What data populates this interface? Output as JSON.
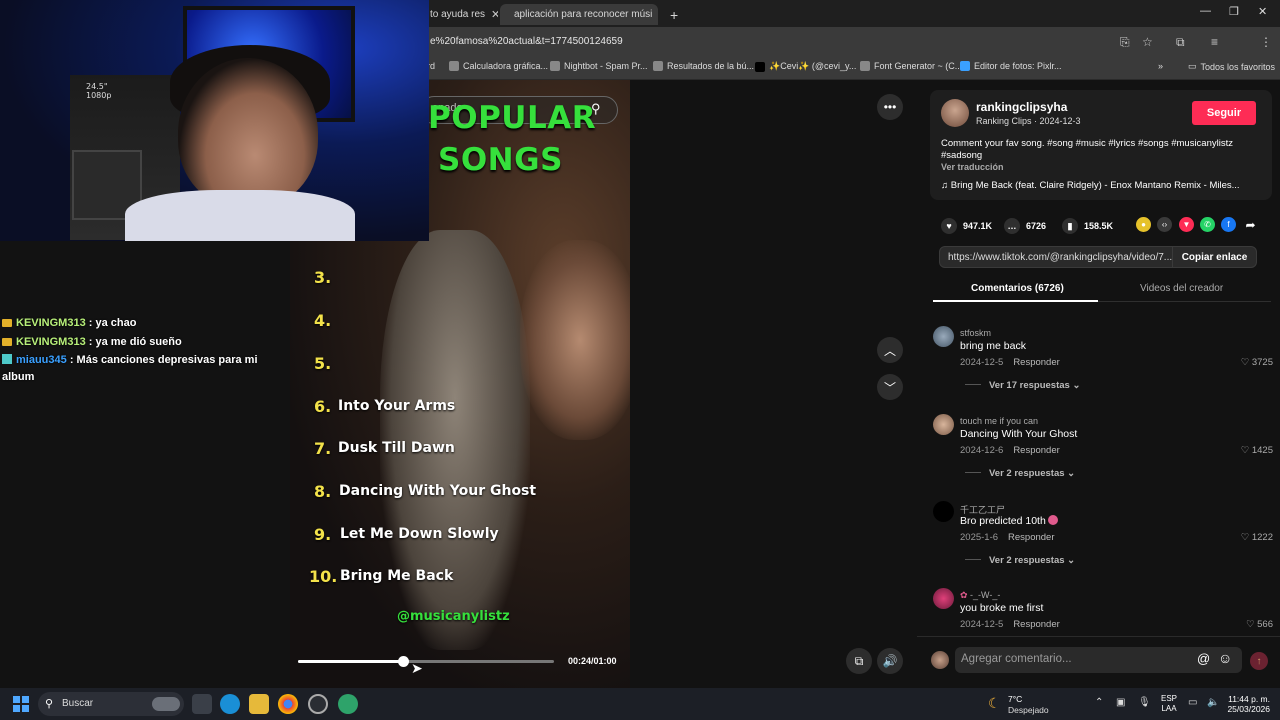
{
  "browser": {
    "tabs": [
      {
        "label": "to ayuda res"
      },
      {
        "label": "aplicación para reconocer músi"
      }
    ],
    "url": "e%20famosa%20actual&t=1774500124659",
    "bookmarks": [
      {
        "label": "rd"
      },
      {
        "label": "Calculadora gráfica..."
      },
      {
        "label": "Nightbot - Spam Pr..."
      },
      {
        "label": "Resultados de la bú..."
      },
      {
        "label": "✨Cevi✨ (@cevi_y..."
      },
      {
        "label": "Font Generator ~ (C..."
      },
      {
        "label": "Editor de fotos: Pixlr..."
      }
    ],
    "all_favorites": "Todos los favoritos"
  },
  "webcam": {
    "screen_label": "24.5\"\n1080p"
  },
  "chat": [
    {
      "user": "KEVINGM313",
      "message": ": ya chao",
      "badge": "crown"
    },
    {
      "user": "KEVINGM313",
      "message": ": ya me dió sueño",
      "badge": "crown"
    },
    {
      "user": "miauu345",
      "message": ": Más canciones depresivas para mi album",
      "badge": "gem"
    }
  ],
  "video": {
    "search_text": "onado",
    "title_line1": "POPULAR",
    "title_line2": "SONGS",
    "ranking": [
      {
        "num": "3.",
        "title": ""
      },
      {
        "num": "4.",
        "title": ""
      },
      {
        "num": "5.",
        "title": ""
      },
      {
        "num": "6.",
        "title": "Into Your Arms"
      },
      {
        "num": "7.",
        "title": "Dusk Till Dawn"
      },
      {
        "num": "8.",
        "title": "Dancing With Your Ghost"
      },
      {
        "num": "9.",
        "title": "Let Me Down Slowly"
      },
      {
        "num": "10.",
        "title": "Bring Me Back"
      }
    ],
    "handle": "@musicanylistz",
    "time": "00:24/01:00",
    "progress": 0.4
  },
  "post": {
    "creator": "rankingclipsyha",
    "subtitle": "Ranking Clips · 2024-12-3",
    "follow": "Seguir",
    "caption": "Comment your fav song. #song #music #lyrics #songs #musicanylistz #sadsong",
    "translate": "Ver traducción",
    "music": "Bring Me Back (feat. Claire Ridgely) - Enox Mantano Remix - Miles...",
    "likes": "947.1K",
    "comments": "6726",
    "saves": "158.5K",
    "link": "https://www.tiktok.com/@rankingclipsyha/video/7...",
    "copy": "Copiar enlace"
  },
  "panel_tabs": {
    "comments": "Comentarios (6726)",
    "creator_videos": "Videos del creador"
  },
  "comments": [
    {
      "user": "stfoskm",
      "text": "bring me back",
      "date": "2024-12-5",
      "reply": "Responder",
      "likes": "3725",
      "more": "Ver 17 respuestas"
    },
    {
      "user": "touch me if you can",
      "text": "Dancing With Your Ghost",
      "date": "2024-12-6",
      "reply": "Responder",
      "likes": "1425",
      "more": "Ver 2 respuestas"
    },
    {
      "user": "千工乙工尸",
      "text": "Bro predicted 10th",
      "date": "2025-1-6",
      "reply": "Responder",
      "likes": "1222",
      "more": "Ver 2 respuestas"
    },
    {
      "user": "-_-W-_-",
      "text": "you broke me first",
      "date": "2024-12-5",
      "reply": "Responder",
      "likes": "566",
      "more": ""
    }
  ],
  "comment_input": {
    "placeholder": "Agregar comentario..."
  },
  "taskbar": {
    "search": "Buscar",
    "temp": "7°C",
    "condition": "Despejado",
    "lang1": "ESP",
    "lang2": "LAA",
    "time": "11:44 p. m.",
    "date": "25/03/2026"
  }
}
